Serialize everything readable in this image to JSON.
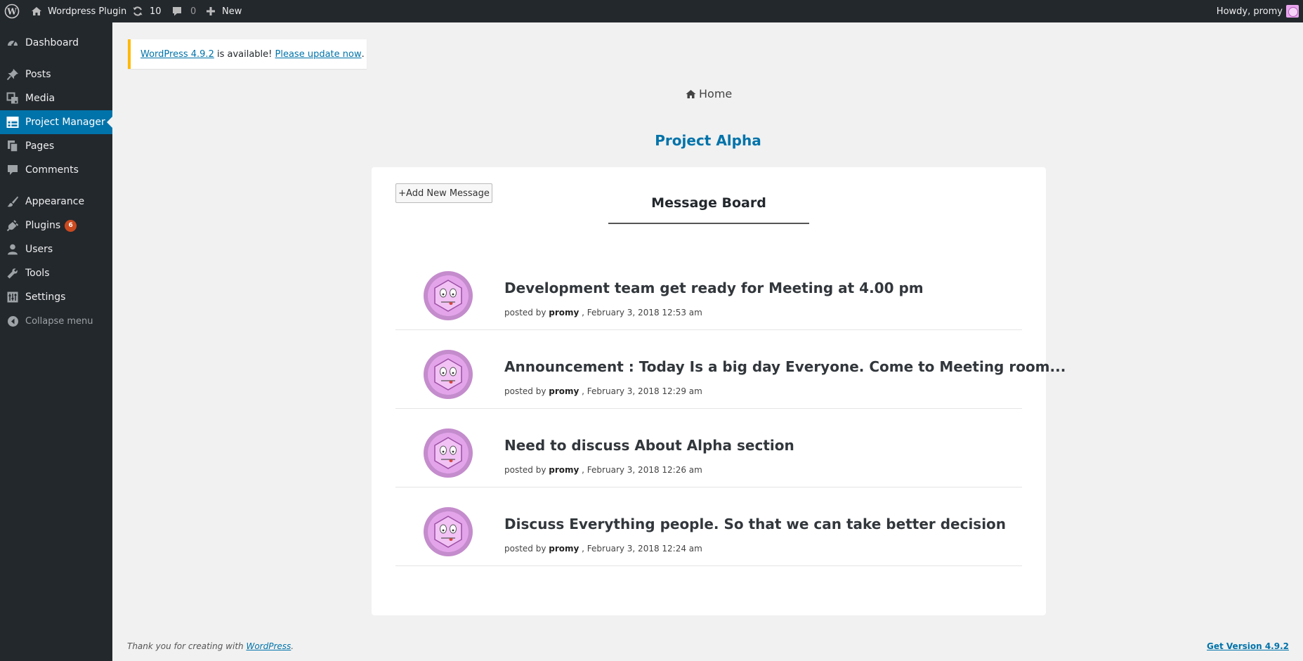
{
  "adminbar": {
    "site_name": "Wordpress Plugin",
    "updates_count": "10",
    "comments_count": "0",
    "new_label": "New",
    "greeting": "Howdy, promy"
  },
  "sidebar": {
    "items": [
      {
        "label": "Dashboard",
        "icon": "dashboard-icon"
      },
      {
        "label": "Posts",
        "icon": "pin-icon"
      },
      {
        "label": "Media",
        "icon": "media-icon"
      },
      {
        "label": "Project Manager",
        "icon": "table-icon"
      },
      {
        "label": "Pages",
        "icon": "pages-icon"
      },
      {
        "label": "Comments",
        "icon": "comment-icon"
      },
      {
        "label": "Appearance",
        "icon": "brush-icon"
      },
      {
        "label": "Plugins",
        "icon": "plug-icon",
        "badge": "6"
      },
      {
        "label": "Users",
        "icon": "user-icon"
      },
      {
        "label": "Tools",
        "icon": "wrench-icon"
      },
      {
        "label": "Settings",
        "icon": "settings-icon"
      },
      {
        "label": "Collapse menu",
        "icon": "collapse-icon"
      }
    ],
    "active": "Project Manager"
  },
  "notice": {
    "version_link": "WordPress 4.9.2",
    "middle_text": " is available! ",
    "update_link": "Please update now",
    "end": "."
  },
  "breadcrumb": {
    "home": "Home"
  },
  "project": {
    "title": "Project Alpha"
  },
  "board": {
    "add_button": "+Add New Message",
    "title": "Message Board",
    "messages": [
      {
        "title": "Development team get ready for Meeting at 4.00 pm",
        "posted_by": "posted by",
        "author": "promy",
        "date": " , February 3, 2018 12:53 am"
      },
      {
        "title": "Announcement : Today Is a big day Everyone. Come to Meeting room...",
        "posted_by": "posted by",
        "author": "promy",
        "date": " , February 3, 2018 12:29 am"
      },
      {
        "title": "Need to discuss About Alpha section",
        "posted_by": "posted by",
        "author": "promy",
        "date": " , February 3, 2018 12:26 am"
      },
      {
        "title": "Discuss Everything people. So that we can take better decision",
        "posted_by": "posted by",
        "author": "promy",
        "date": " , February 3, 2018 12:24 am"
      }
    ]
  },
  "footer": {
    "thanks_text": "Thank you for creating with ",
    "wp_link": "WordPress",
    "thanks_end": ".",
    "version_link": "Get Version 4.9.2"
  },
  "colors": {
    "accent": "#0073aa",
    "adminbar": "#23282d",
    "notice_border": "#ffb900",
    "badge": "#ca4a1f"
  }
}
